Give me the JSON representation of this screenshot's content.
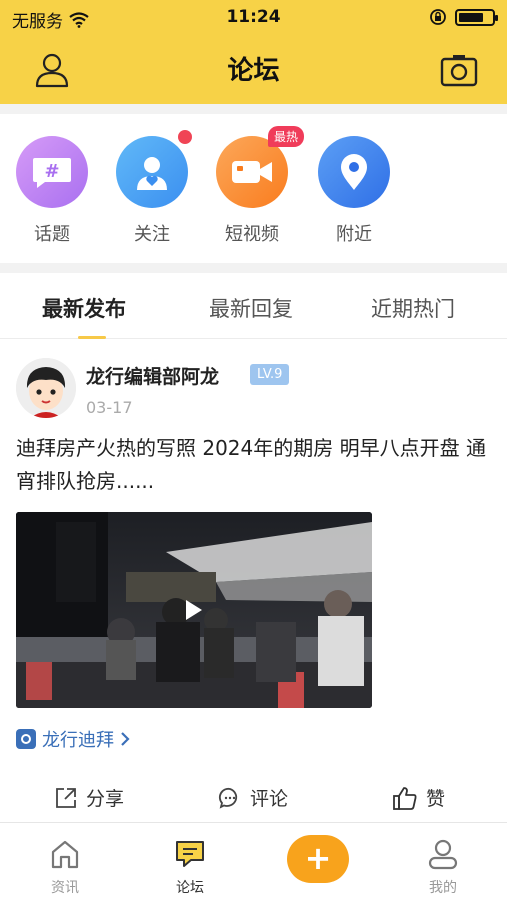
{
  "status_bar": {
    "carrier": "无服务",
    "time": "11:24"
  },
  "header": {
    "title": "论坛"
  },
  "categories": [
    {
      "label": "话题",
      "icon": "hashtag-icon",
      "color": "#c98af5"
    },
    {
      "label": "关注",
      "icon": "person-heart-icon",
      "color": "#4aa7f4"
    },
    {
      "label": "短视频",
      "icon": "video-camera-icon",
      "color": "#fb8a2f",
      "badge": "最热"
    },
    {
      "label": "附近",
      "icon": "location-pin-icon",
      "color": "#3f86ef"
    }
  ],
  "tabs": [
    "最新发布",
    "最新回复",
    "近期热门"
  ],
  "post": {
    "author": "龙行编辑部阿龙",
    "level": "LV.9",
    "date": "03-17",
    "content": "迪拜房产火热的写照 2024年的期房 明早八点开盘 通宵排队抢房......",
    "topic": "龙行迪拜",
    "actions": {
      "share": "分享",
      "comment": "评论",
      "like": "赞"
    }
  },
  "tabbar": {
    "news": "资讯",
    "forum": "论坛",
    "me": "我的",
    "post_button": "+"
  }
}
